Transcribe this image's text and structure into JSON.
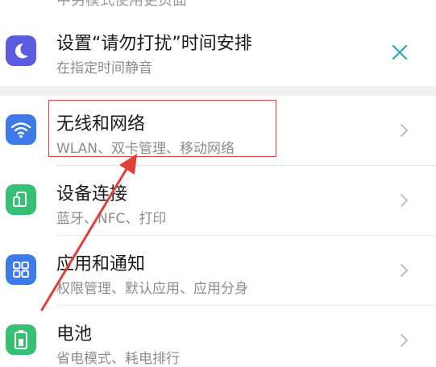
{
  "top_partial": {
    "text": "中另模式使用更页面"
  },
  "dnd": {
    "title": "设置“请勿打扰”时间安排",
    "subtitle": "在指定时间静音"
  },
  "items": [
    {
      "title": "无线和网络",
      "subtitle": "WLAN、双卡管理、移动网络",
      "icon": "wifi-icon"
    },
    {
      "title": "设备连接",
      "subtitle": "蓝牙、NFC、打印",
      "icon": "device-connect-icon"
    },
    {
      "title": "应用和通知",
      "subtitle": "权限管理、默认应用、应用分身",
      "icon": "apps-grid-icon"
    },
    {
      "title": "电池",
      "subtitle": "省电模式、耗电排行",
      "icon": "battery-icon"
    }
  ],
  "colors": {
    "moon": "#5c5ce0",
    "wifi": "#3d7ae8",
    "device": "#35c074",
    "apps": "#3d7ae8",
    "battery": "#35c074",
    "close": "#29a6b8",
    "annotation": "#e0403a"
  }
}
